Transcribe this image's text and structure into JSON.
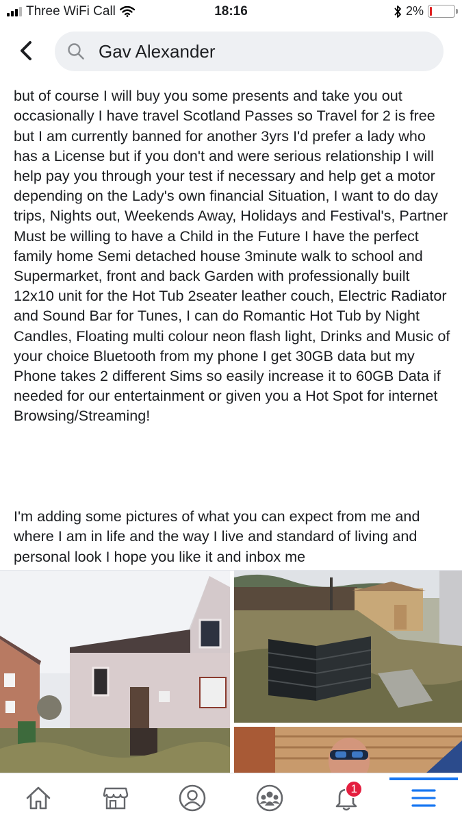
{
  "status_bar": {
    "carrier": "Three WiFi Call",
    "time": "18:16",
    "battery_percent": "2%",
    "battery_level": 0.02
  },
  "search": {
    "query": "Gav Alexander"
  },
  "post": {
    "paragraph1": "but of course I will buy you some presents and take you out occasionally I have travel Scotland Passes so Travel for 2 is free but I am currently banned for another 3yrs I'd prefer a lady who has a License but if you don't and were serious relationship I will help pay you through your test if necessary and help get a motor depending on the Lady's own financial Situation, I want to do day trips, Nights out, Weekends Away, Holidays and Festival's, Partner Must be willing to have a Child in the Future I have the perfect family home Semi detached house 3minute walk to school and Supermarket, front and back Garden with professionally built 12x10 unit for the Hot Tub 2seater leather couch, Electric Radiator and Sound Bar for Tunes, I can do Romantic Hot Tub by Night Candles, Floating multi colour neon flash light, Drinks and Music of your choice Bluetooth from my phone I get 30GB data but my Phone takes 2 different Sims so easily increase it to 60GB Data if needed for our entertainment or given you a Hot Spot for internet Browsing/Streaming!",
    "paragraph2": "I'm adding some pictures of what you can expect from me and where I am in life and the way I live and standard of living and personal look I hope you like it and inbox me",
    "emoji": "heart-eyes-emoji"
  },
  "nav": {
    "items": [
      "home-icon",
      "marketplace-icon",
      "profile-icon",
      "groups-icon",
      "notifications-icon",
      "menu-icon"
    ],
    "notification_count": "1",
    "accent": "#1877f2",
    "badge_color": "#e41e3f"
  }
}
